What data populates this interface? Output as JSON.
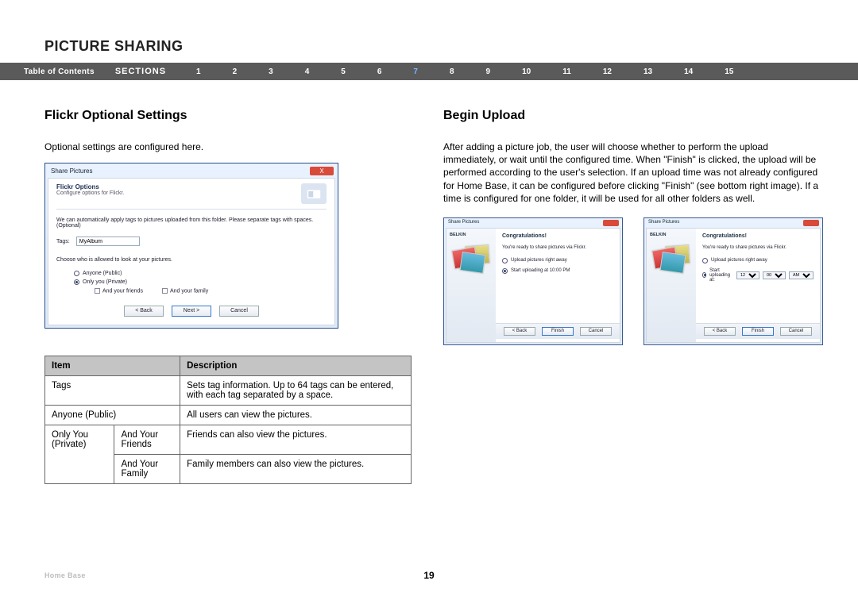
{
  "page_title": "PICTURE SHARING",
  "nav": {
    "toc": "Table of Contents",
    "sections_label": "SECTIONS",
    "sections": [
      "1",
      "2",
      "3",
      "4",
      "5",
      "6",
      "7",
      "8",
      "9",
      "10",
      "11",
      "12",
      "13",
      "14",
      "15"
    ],
    "active_section": "7"
  },
  "left": {
    "heading": "Flickr Optional Settings",
    "lead": "Optional settings are configured here.",
    "dialog": {
      "window_title": "Share Pictures",
      "close_label": "X",
      "hdr_title": "Flickr Options",
      "hdr_sub": "Configure options for Flickr.",
      "line1": "We can automatically apply tags to pictures uploaded from this folder. Please separate tags with spaces. (Optional)",
      "tags_label": "Tags:",
      "tags_value": "MyAlbum",
      "line2": "Choose who is allowed to look at your pictures.",
      "radio_anyone": "Anyone (Public)",
      "radio_onlyyou": "Only you (Private)",
      "cb_friends": "And your friends",
      "cb_family": "And your family",
      "btn_back": "< Back",
      "btn_next": "Next >",
      "btn_cancel": "Cancel"
    },
    "table": {
      "h_item": "Item",
      "h_desc": "Description",
      "rows": [
        {
          "item": "Tags",
          "sub": "",
          "desc": "Sets tag information. Up to 64 tags can be entered, with each tag separated by a space."
        },
        {
          "item": "Anyone (Public)",
          "sub": "",
          "desc": "All users can view the pictures."
        },
        {
          "item": "Only You (Private)",
          "sub": "And Your Friends",
          "desc": "Friends can also view the pictures."
        },
        {
          "item": "",
          "sub": "And Your Family",
          "desc": "Family members can also view the pictures."
        }
      ]
    }
  },
  "right": {
    "heading": "Begin Upload",
    "body": "After adding a picture job, the user will choose whether to perform the upload immediately, or wait until the configured time. When \"Finish\" is clicked, the upload will be performed according to the user's selection. If an upload time was not already configured for Home Base, it can be configured before clicking \"Finish\" (see bottom right image). If a time is configured for one folder, it will be used for all other folders as well.",
    "dialog1": {
      "window_title": "Share Pictures",
      "brand": "BELKIN",
      "ctitle": "Congratulations!",
      "msg": "You're ready to share pictures via Flickr.",
      "opt_now": "Upload pictures right away",
      "opt_time": "Start uploading at 10:00 PM",
      "btn_back": "< Back",
      "btn_finish": "Finish",
      "btn_cancel": "Cancel"
    },
    "dialog2": {
      "window_title": "Share Pictures",
      "brand": "BELKIN",
      "ctitle": "Congratulations!",
      "msg": "You're ready to share pictures via Flickr.",
      "opt_now": "Upload pictures right away",
      "opt_time_label": "Start uploading at:",
      "hour": "12",
      "minute": "00",
      "ampm": "AM",
      "btn_back": "< Back",
      "btn_finish": "Finish",
      "btn_cancel": "Cancel"
    }
  },
  "footer": {
    "product": "Home Base",
    "page_number": "19"
  }
}
